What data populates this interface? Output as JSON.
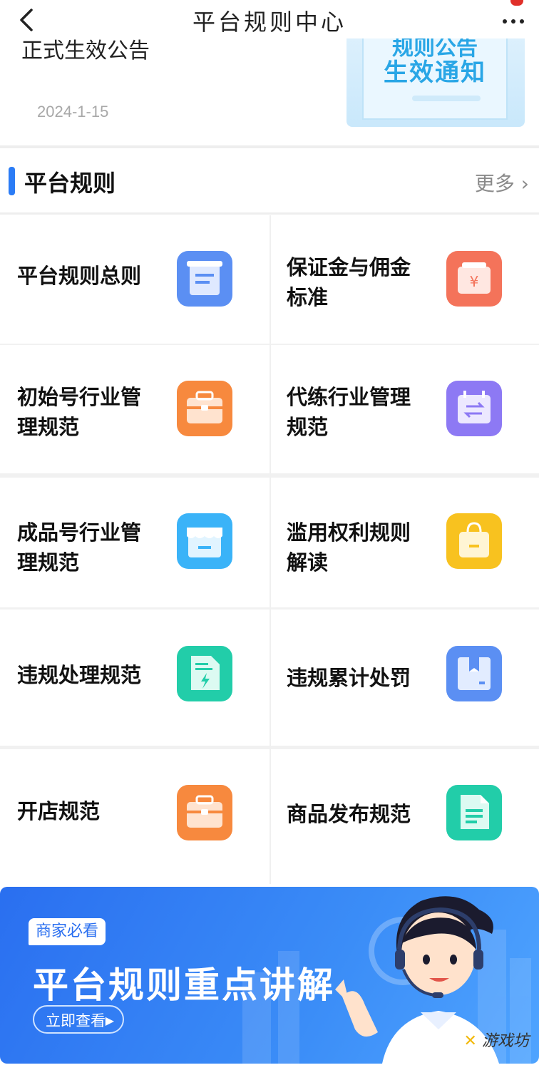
{
  "nav": {
    "title": "平台规则中心"
  },
  "notice": {
    "title_partial": "正式生效公告",
    "date": "2024-1-15",
    "thumb_line1": "规则公告",
    "thumb_line2": "生效通知"
  },
  "section": {
    "title": "平台规则",
    "more": "更多"
  },
  "rules": [
    {
      "label": "平台规则总则",
      "icon": "document-icon",
      "color": "#5b8ff3"
    },
    {
      "label": "保证金与佣金标准",
      "icon": "yuan-bag-icon",
      "color": "#f4735a"
    },
    {
      "label": "初始号行业管理规范",
      "icon": "briefcase-icon",
      "color": "#f7893e"
    },
    {
      "label": "代练行业管理规范",
      "icon": "exchange-calendar-icon",
      "color": "#8d79f4"
    },
    {
      "label": "成品号行业管理规范",
      "icon": "store-icon",
      "color": "#3ab3f8"
    },
    {
      "label": "滥用权利规则解读",
      "icon": "shopping-bag-icon",
      "color": "#f8c21f"
    },
    {
      "label": "违规处理规范",
      "icon": "file-lightning-icon",
      "color": "#22cda9"
    },
    {
      "label": "违规累计处罚",
      "icon": "box-icon",
      "color": "#5b8ff3"
    },
    {
      "label": "开店规范",
      "icon": "briefcase-icon",
      "color": "#f7893e"
    },
    {
      "label": "商品发布规范",
      "icon": "file-lines-icon",
      "color": "#22cda9"
    }
  ],
  "banner": {
    "tag": "商家必看",
    "headline": "平台规则重点讲解",
    "cta": "立即查看",
    "watermark": "游戏坊"
  }
}
